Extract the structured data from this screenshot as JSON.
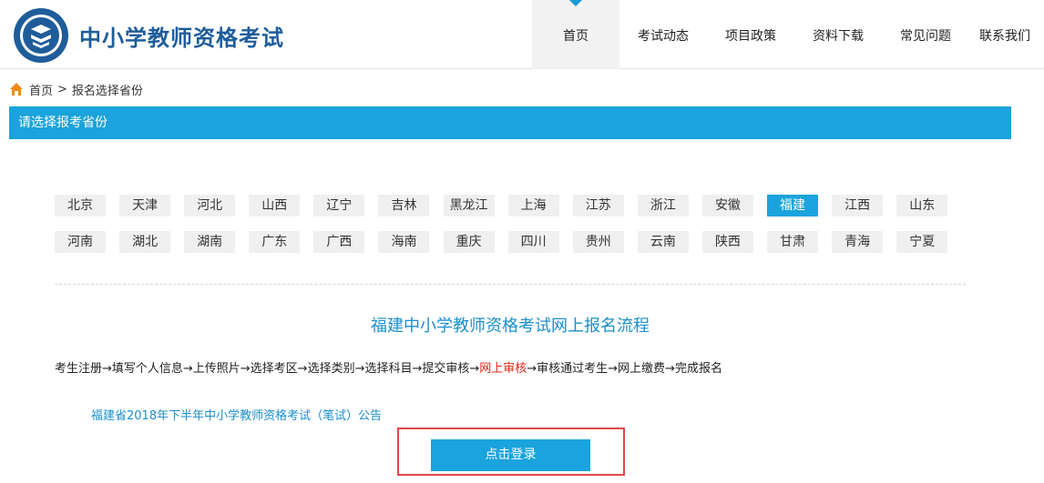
{
  "header": {
    "site_title": "中小学教师资格考试",
    "nav": [
      {
        "label": "首页",
        "active": true
      },
      {
        "label": "考试动态"
      },
      {
        "label": "项目政策"
      },
      {
        "label": "资料下载"
      },
      {
        "label": "常见问题"
      },
      {
        "label": "联系我们"
      }
    ]
  },
  "breadcrumb": {
    "home": "首页",
    "separator": ">",
    "current": "报名选择省份"
  },
  "section": {
    "title": "请选择报考省份"
  },
  "provinces": [
    "北京",
    "天津",
    "河北",
    "山西",
    "辽宁",
    "吉林",
    "黑龙江",
    "上海",
    "江苏",
    "浙江",
    "安徽",
    "福建",
    "江西",
    "山东",
    "河南",
    "湖北",
    "湖南",
    "广东",
    "广西",
    "海南",
    "重庆",
    "四川",
    "贵州",
    "云南",
    "陕西",
    "甘肃",
    "青海",
    "宁夏"
  ],
  "selected_province": "福建",
  "process": {
    "title": "福建中小学教师资格考试网上报名流程",
    "steps_before": "考生注册→填写个人信息→上传照片→选择考区→选择类别→选择科目→提交审核→",
    "steps_highlight": "网上审核",
    "steps_after": "→审核通过考生→网上缴费→完成报名"
  },
  "notice": {
    "text": "福建省2018年下半年中小学教师资格考试（笔试）公告"
  },
  "login": {
    "label": "点击登录"
  },
  "colors": {
    "accent": "#1aa3dc",
    "title_blue": "#1f5d9a",
    "highlight_red": "#e2231a"
  }
}
